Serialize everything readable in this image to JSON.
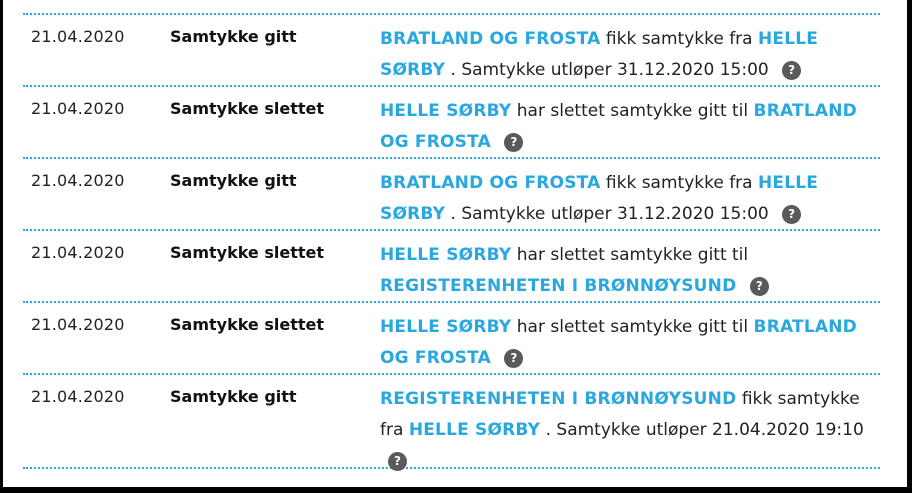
{
  "help_icon_glyph": "?",
  "colors": {
    "link": "#29a8e0",
    "divider": "#29a8e0",
    "help_icon_bg": "#5a5a5a"
  },
  "rows": [
    {
      "date": "21.04.2020",
      "type": "Samtykke gitt",
      "a": "BRATLAND OG FROSTA",
      "m1": "fikk samtykke fra",
      "b": "HELLE SØRBY",
      "m2": ". Samtykke utløper 31.12.2020 15:00"
    },
    {
      "date": "21.04.2020",
      "type": "Samtykke slettet",
      "a": "HELLE SØRBY",
      "m1": "har slettet samtykke gitt til",
      "b": "BRATLAND OG FROSTA"
    },
    {
      "date": "21.04.2020",
      "type": "Samtykke gitt",
      "a": "BRATLAND OG FROSTA",
      "m1": "fikk samtykke fra",
      "b": "HELLE SØRBY",
      "m2": ". Samtykke utløper 31.12.2020 15:00"
    },
    {
      "date": "21.04.2020",
      "type": "Samtykke slettet",
      "a": "HELLE SØRBY",
      "m1": "har slettet samtykke gitt til",
      "b": "REGISTERENHETEN I BRØNNØYSUND"
    },
    {
      "date": "21.04.2020",
      "type": "Samtykke slettet",
      "a": "HELLE SØRBY",
      "m1": "har slettet samtykke gitt til",
      "b": "BRATLAND OG FROSTA"
    },
    {
      "date": "21.04.2020",
      "type": "Samtykke gitt",
      "a": "REGISTERENHETEN I BRØNNØYSUND",
      "m1": "fikk samtykke fra",
      "b": "HELLE SØRBY",
      "m2": ". Samtykke utløper 21.04.2020 19:10"
    }
  ]
}
